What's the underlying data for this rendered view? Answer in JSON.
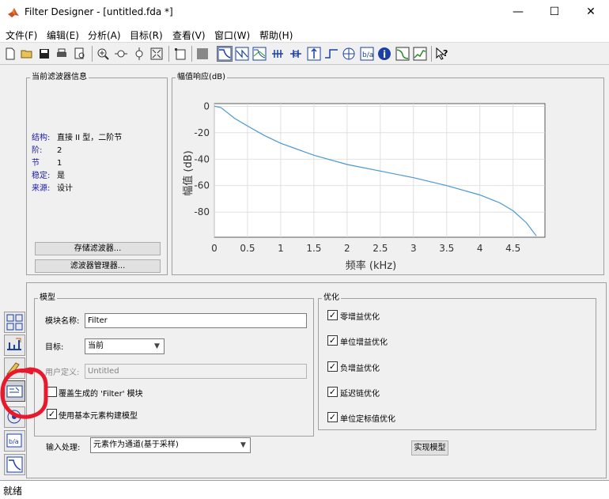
{
  "window": {
    "title": "Filter Designer -  [untitled.fda *]",
    "minimize": "—",
    "maximize": "☐",
    "close": "✕"
  },
  "menu": [
    "文件(F)",
    "编辑(E)",
    "分析(A)",
    "目标(R)",
    "查看(V)",
    "窗口(W)",
    "帮助(H)"
  ],
  "toolbar": {
    "icons": [
      "new-file-icon",
      "open-icon",
      "save-icon",
      "print-icon",
      "print-preview-icon",
      "zoom-in-icon",
      "zoom-x-icon",
      "zoom-y-icon",
      "full-view-icon",
      "new-window-icon",
      "filter-spec-icon",
      "magnitude-response-icon",
      "phase-response-icon",
      "magnitude-phase-icon",
      "group-delay-icon",
      "phase-delay-icon",
      "impulse-response-icon",
      "step-response-icon",
      "pole-zero-icon",
      "coefficients-icon",
      "info-icon",
      "magnitude-estimate-icon",
      "round-off-noise-icon",
      "whats-this-icon"
    ]
  },
  "current_filter": {
    "title": "当前滤波器信息",
    "rows": [
      {
        "key": "结构:",
        "value": "直接 II 型，二阶节"
      },
      {
        "key": "阶:",
        "value": "2"
      },
      {
        "key": "节",
        "value": "1"
      },
      {
        "key": "稳定:",
        "value": "是"
      },
      {
        "key": "来源:",
        "value": "设计"
      }
    ],
    "store_button": "存储滤波器...",
    "manager_button": "滤波器管理器..."
  },
  "magnitude_panel": {
    "title": "幅值响应(dB)"
  },
  "chart_data": {
    "type": "line",
    "title": "",
    "xlabel": "频率 (kHz)",
    "ylabel": "幅值 (dB)",
    "xlim": [
      0,
      4.98
    ],
    "ylim": [
      -99,
      2
    ],
    "xticks": [
      "0",
      "0.5",
      "1",
      "1.5",
      "2",
      "2.5",
      "3",
      "3.5",
      "4",
      "4.5"
    ],
    "yticks": [
      "0",
      "-20",
      "-40",
      "-60",
      "-80"
    ],
    "grid": true,
    "color": "#4a98d0",
    "series": [
      {
        "x": [
          0,
          0.1,
          0.2,
          0.3,
          0.5,
          0.75,
          1.0,
          1.5,
          2.0,
          2.5,
          3.0,
          3.5,
          4.0,
          4.3,
          4.5,
          4.7,
          4.85
        ],
        "y": [
          0,
          -1,
          -5,
          -9,
          -15,
          -22,
          -28,
          -37,
          -44,
          -49,
          -54,
          -60,
          -67,
          -73,
          -79,
          -88,
          -98
        ]
      }
    ]
  },
  "model": {
    "title": "模型",
    "block_name_label": "模块名称:",
    "block_name_value": "Filter",
    "target_label": "目标:",
    "target_value": "当前",
    "user_defined_label": "用户定义:",
    "user_defined_value": "Untitled",
    "overwrite_label": "覆盖生成的 'Filter' 模块",
    "overwrite_checked": false,
    "basic_elements_label": "使用基本元素构建模型",
    "basic_elements_checked": true,
    "input_processing_label": "输入处理:",
    "input_processing_value": "元素作为通道(基于采样)"
  },
  "optimization": {
    "title": "优化",
    "options": [
      {
        "label": "零增益优化",
        "checked": true
      },
      {
        "label": "单位增益优化",
        "checked": true
      },
      {
        "label": "负增益优化",
        "checked": true
      },
      {
        "label": "延迟链优化",
        "checked": true
      },
      {
        "label": "单位定标值优化",
        "checked": true
      }
    ],
    "realize_button": "实现模型"
  },
  "sidebar": {
    "icons": [
      "transform-filter-icon",
      "create-multirate-icon",
      "quantize-icon",
      "realize-model-icon",
      "pole-zero-editor-icon",
      "import-filter-icon",
      "design-filter-icon"
    ]
  },
  "annotation_color": "#e8192c",
  "status": "就绪"
}
